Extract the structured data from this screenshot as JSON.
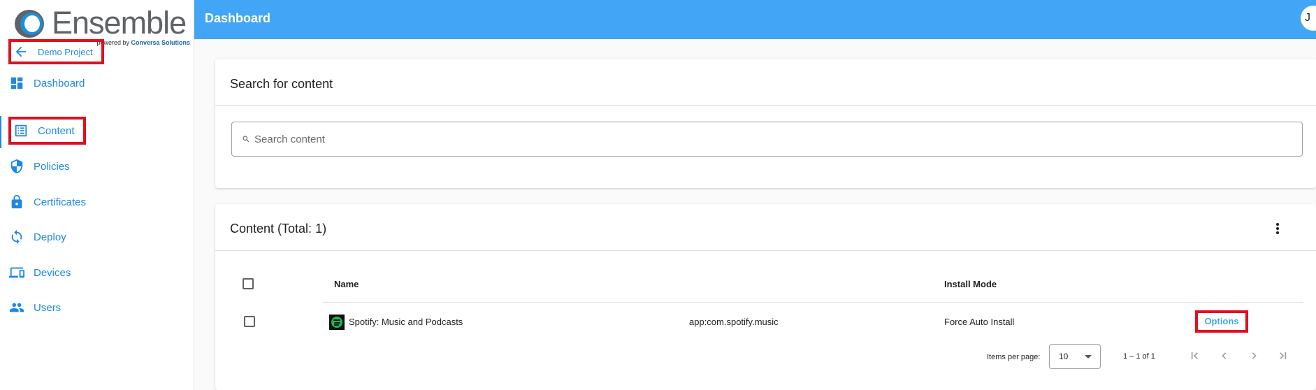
{
  "brand": {
    "name": "Ensemble",
    "powered_prefix": "powered by",
    "powered_company": "Conversa Solutions"
  },
  "sidebar": {
    "items": [
      {
        "label": "Demo Project",
        "icon": "arrow-back-icon"
      },
      {
        "label": "Dashboard",
        "icon": "dashboard-icon"
      },
      {
        "label": "Content",
        "icon": "list-alt-icon"
      },
      {
        "label": "Policies",
        "icon": "shield-icon"
      },
      {
        "label": "Certificates",
        "icon": "lock-icon"
      },
      {
        "label": "Deploy",
        "icon": "sync-icon"
      },
      {
        "label": "Devices",
        "icon": "devices-icon"
      },
      {
        "label": "Users",
        "icon": "people-icon"
      }
    ]
  },
  "header": {
    "title": "Dashboard",
    "avatar_initial": "J"
  },
  "search_card": {
    "title": "Search for content",
    "placeholder": "Search content",
    "value": ""
  },
  "content_card": {
    "title": "Content (Total: 1)",
    "columns": [
      "Name",
      "",
      "Install Mode"
    ],
    "rows": [
      {
        "name": "Spotify: Music and Podcasts",
        "package": "app:com.spotify.music",
        "install_mode": "Force Auto Install",
        "action": "Options",
        "icon": "spotify-icon"
      }
    ]
  },
  "pagination": {
    "items_per_page_label": "Items per page:",
    "items_per_page": "10",
    "range": "1 – 1 of 1"
  },
  "colors": {
    "header": "#42a5f5",
    "accent": "#1e88e5",
    "highlight": "#e0101f"
  }
}
